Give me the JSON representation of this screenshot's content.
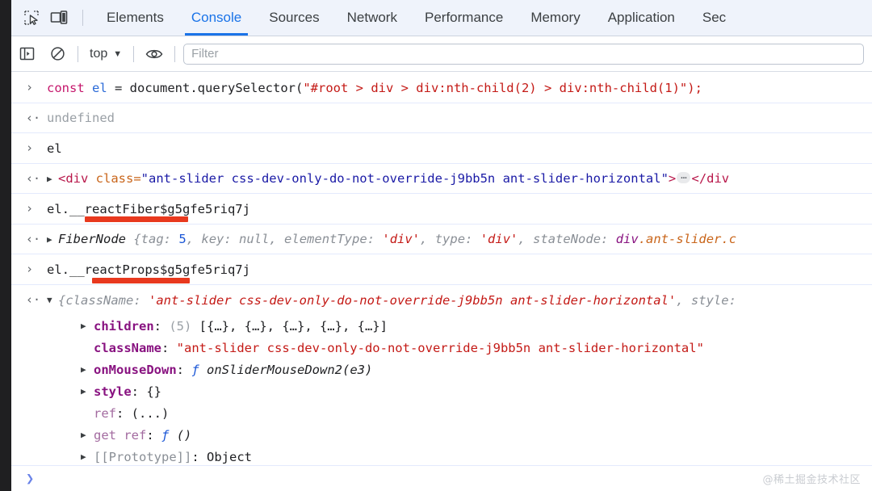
{
  "window": {
    "title": "Chrome DevTools - Console",
    "accent_color": "#1a73e8",
    "tabbar_bg": "#eff3fb",
    "annotation_color": "#e8391e"
  },
  "toolbar": {
    "icons": [
      {
        "name": "inspect-element-icon",
        "label": "Inspect element"
      },
      {
        "name": "device-toolbar-icon",
        "label": "Toggle device toolbar"
      }
    ],
    "tabs": [
      {
        "label": "Elements",
        "active": false
      },
      {
        "label": "Console",
        "active": true
      },
      {
        "label": "Sources",
        "active": false
      },
      {
        "label": "Network",
        "active": false
      },
      {
        "label": "Performance",
        "active": false
      },
      {
        "label": "Memory",
        "active": false
      },
      {
        "label": "Application",
        "active": false
      },
      {
        "label": "Sec",
        "active": false
      }
    ]
  },
  "filterbar": {
    "sidebar_toggle": "show-console-sidebar-icon",
    "clear_console": "clear-console-icon",
    "context_label": "top",
    "context_caret": "▼",
    "eye_icon": "live-expression-eye-icon",
    "filter_placeholder": "Filter",
    "filter_value": ""
  },
  "console": {
    "input_marker": "›",
    "output_marker": "‹·",
    "collapsed_triangle": "▶",
    "expanded_triangle": "▼",
    "entries": [
      {
        "type": "input",
        "text": "const el = document.querySelector(\"#root > div > div:nth-child(2) > div:nth-child(1)\");",
        "parts": {
          "keyword": "const",
          "variable": "el",
          "assign": " = document.querySelector(",
          "string": "\"#root > div > div:nth-child(2) > div:nth-child(1)\"",
          "tail": ");"
        }
      },
      {
        "type": "output",
        "text": "undefined"
      },
      {
        "type": "input",
        "text": "el"
      },
      {
        "type": "output-node",
        "tag_open": "<div",
        "attr_name": "class=",
        "attr_value": "\"ant-slider css-dev-only-do-not-override-j9bb5n ant-slider-horizontal\"",
        "gt": ">",
        "ellipsis": "⋯",
        "tag_close": "</div"
      },
      {
        "type": "input",
        "text": "el.__reactFiber$g5gfe5riq7j",
        "annotated_segment": "__reactFiber"
      },
      {
        "type": "output-object",
        "class_name": "FiberNode",
        "preview": "{tag: 5, key: null, elementType: 'div', type: 'div', stateNode: div.ant-slider.c",
        "props": [
          {
            "key": "tag",
            "value": "5",
            "kind": "number"
          },
          {
            "key": "key",
            "value": "null",
            "kind": "null"
          },
          {
            "key": "elementType",
            "value": "'div'",
            "kind": "string"
          },
          {
            "key": "type",
            "value": "'div'",
            "kind": "string"
          },
          {
            "key": "stateNode",
            "value": "div.ant-slider.c",
            "kind": "node"
          }
        ]
      },
      {
        "type": "input",
        "text": "el.__reactProps$g5gfe5riq7j",
        "annotated_segment": "_reactProps"
      },
      {
        "type": "output-object-expanded",
        "preview_open": "{",
        "preview_key": "className",
        "preview_value": "'ant-slider css-dev-only-do-not-override-j9bb5n ant-slider-horizontal'",
        "preview_tail_key": "style:",
        "rows": [
          {
            "triangle": true,
            "key": "children",
            "bold": true,
            "count": "(5)",
            "value": "[{…}, {…}, {…}, {…}, {…}]",
            "kind": "array"
          },
          {
            "triangle": false,
            "key": "className",
            "bold": true,
            "count": "",
            "value": "\"ant-slider css-dev-only-do-not-override-j9bb5n ant-slider-horizontal\"",
            "kind": "string"
          },
          {
            "triangle": true,
            "key": "onMouseDown",
            "bold": true,
            "count": "",
            "value": "onSliderMouseDown2(e3)",
            "kind": "function",
            "fn_symbol": "ƒ"
          },
          {
            "triangle": true,
            "key": "style",
            "bold": true,
            "count": "",
            "value": "{}",
            "kind": "object"
          },
          {
            "triangle": false,
            "key": "ref",
            "bold": false,
            "count": "",
            "value": "(...)",
            "kind": "getter"
          },
          {
            "triangle": true,
            "key": "get ref",
            "bold": false,
            "count": "",
            "value": "()",
            "kind": "function",
            "fn_symbol": "ƒ"
          },
          {
            "triangle": true,
            "key": "[[Prototype]]",
            "bold": false,
            "count": "",
            "value": "Object",
            "kind": "prototype"
          }
        ]
      }
    ]
  },
  "prompt": {
    "chevron": "❯",
    "value": ""
  },
  "watermark": {
    "text": "@稀土掘金技术社区"
  }
}
